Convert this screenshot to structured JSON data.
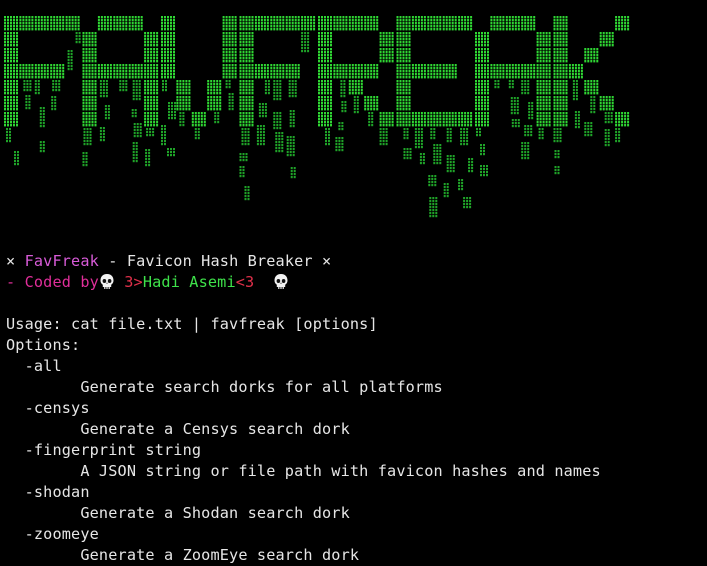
{
  "banner": {
    "text": "FAVFREAK",
    "color": "#2fd633",
    "drip_color": "#1fa328"
  },
  "header": {
    "close_left": "⨯",
    "app_name": "FavFreak",
    "dash_title": " - Favicon Hash Breaker ",
    "close_right": "⨯",
    "coded_prefix": "- Coded by",
    "author_pre": " 3>",
    "author_name": "Hadi Asemi",
    "author_post": "<3  "
  },
  "usage": {
    "usage_line": "Usage: cat file.txt | favfreak [options]",
    "options_label": "Options:",
    "options": [
      {
        "flag": "  -all",
        "desc": "        Generate search dorks for all platforms"
      },
      {
        "flag": "  -censys",
        "desc": "        Generate a Censys search dork"
      },
      {
        "flag": "  -fingerprint string",
        "desc": "        A JSON string or file path with favicon hashes and names"
      },
      {
        "flag": "  -shodan",
        "desc": "        Generate a Shodan search dork"
      },
      {
        "flag": "  -zoomeye",
        "desc": "        Generate a ZoomEye search dork"
      }
    ]
  },
  "colors": {
    "background": "#000000",
    "app_name": "#d85bd8",
    "coded_by": "#e02e9a",
    "author_marks": "#e0304a",
    "author_name": "#3ee24a",
    "text": "#e6e6e6"
  },
  "icons": [
    "skull-icon"
  ]
}
